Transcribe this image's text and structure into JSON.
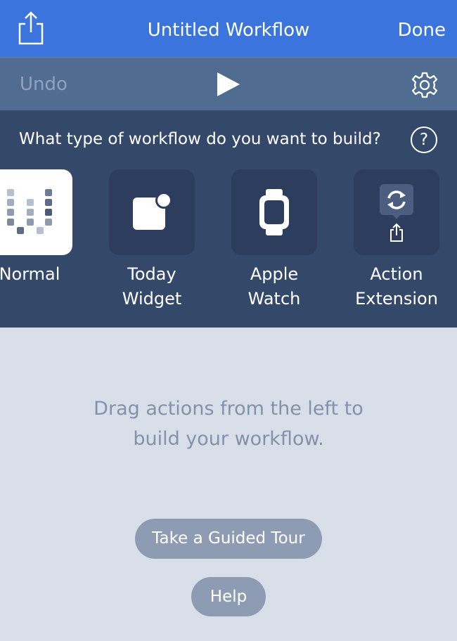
{
  "navbar": {
    "title": "Untitled Workflow",
    "done_label": "Done",
    "share_icon": "share-icon"
  },
  "toolbar": {
    "undo_label": "Undo",
    "play_icon": "play-icon",
    "settings_icon": "gear-icon"
  },
  "workflow_types": {
    "question": "What type of workflow do you want to build?",
    "help_symbol": "?",
    "items": [
      {
        "label": "Normal",
        "icon": "normal-grid-icon",
        "selected": true
      },
      {
        "label_line1": "Today",
        "label_line2": "Widget",
        "icon": "today-widget-icon"
      },
      {
        "label_line1": "Apple",
        "label_line2": "Watch",
        "icon": "apple-watch-icon"
      },
      {
        "label_line1": "Action",
        "label_line2": "Extension",
        "icon": "action-extension-icon"
      }
    ]
  },
  "canvas": {
    "message_line1": "Drag actions from the left to",
    "message_line2": "build your workflow.",
    "tour_button": "Take a Guided Tour",
    "help_button": "Help"
  },
  "colors": {
    "navbar": "#3a74dc",
    "toolbar": "#506c90",
    "panel": "#34486a",
    "tile": "#2c3d5e",
    "canvas": "#d8dfe9",
    "pill": "#8d9bb3"
  }
}
